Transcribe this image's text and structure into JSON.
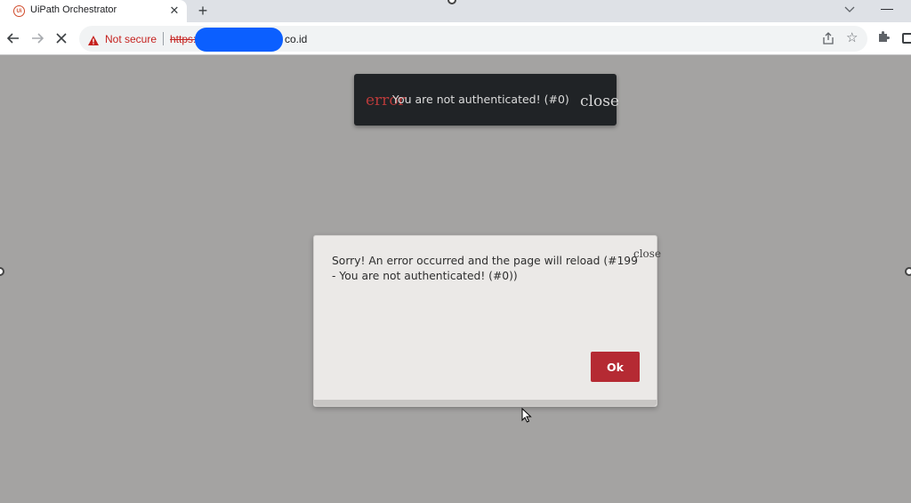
{
  "browser": {
    "tab": {
      "title": "UiPath Orchestrator",
      "close": "✕",
      "favicon_text": "Ui"
    },
    "new_tab": "+",
    "tab_search_icon": "chevron-down-icon",
    "window_min": "—",
    "address": {
      "security_label": "Not secure",
      "url_scheme": "https:",
      "url_domain": "co.id"
    }
  },
  "page": {
    "toast": {
      "icon_text": "error",
      "message": "You are not authenticated! (#0)",
      "close_text": "close"
    },
    "dialog": {
      "message": "Sorry! An error occurred and the page will reload (#199 - You are not authenticated! (#0))",
      "close_text": "close",
      "ok_label": "Ok"
    }
  },
  "colors": {
    "overlay": "#a4a3a2",
    "toast_bg": "#202326",
    "dialog_bg": "#ebe9e7",
    "ok_button": "#b52a33",
    "insecure_red": "#c5221f"
  }
}
